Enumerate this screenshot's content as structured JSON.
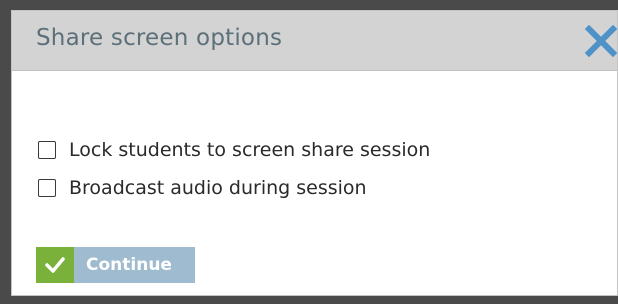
{
  "dialog": {
    "title": "Share screen options",
    "close_icon": "close-x-icon",
    "options": [
      {
        "label": "Lock students to screen share session",
        "checked": false
      },
      {
        "label": "Broadcast audio during session",
        "checked": false
      }
    ],
    "continue_button": {
      "label": "Continue",
      "icon": "checkmark-icon"
    }
  },
  "colors": {
    "header_bg": "#d3d3d3",
    "title_text": "#5c7079",
    "close_icon": "#4f92c8",
    "continue_bg": "#9fbbd0",
    "continue_icon_bg": "#79b13b"
  }
}
